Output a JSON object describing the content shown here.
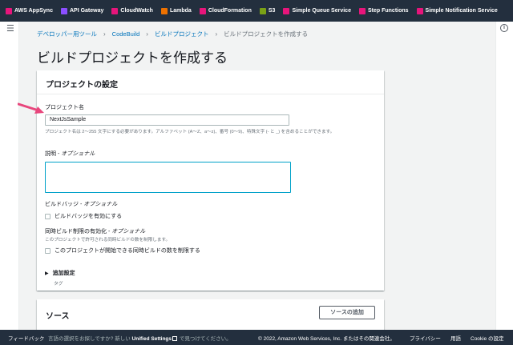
{
  "favorites": [
    {
      "label": "AWS AppSync",
      "color": "#e7157b"
    },
    {
      "label": "API Gateway",
      "color": "#8c4fff"
    },
    {
      "label": "CloudWatch",
      "color": "#e7157b"
    },
    {
      "label": "Lambda",
      "color": "#ed7100"
    },
    {
      "label": "CloudFormation",
      "color": "#e7157b"
    },
    {
      "label": "S3",
      "color": "#7aa116"
    },
    {
      "label": "Simple Queue Service",
      "color": "#e7157b"
    },
    {
      "label": "Step Functions",
      "color": "#e7157b"
    },
    {
      "label": "Simple Notification Service",
      "color": "#e7157b"
    }
  ],
  "breadcrumb": {
    "items": [
      "デベロッパー用ツール",
      "CodeBuild",
      "ビルドプロジェクト"
    ],
    "current": "ビルドプロジェクトを作成する"
  },
  "page_title": "ビルドプロジェクトを作成する",
  "config_panel": {
    "title": "プロジェクトの設定",
    "project_name": {
      "label": "プロジェクト名",
      "value": "NextJsSample",
      "hint": "プロジェクト名は 2〜255 文字にする必要があります。アルファベット (A〜Z、a〜z)、番号 (0〜9)、特殊文字 (- と _) を含めることができます。"
    },
    "description": {
      "label": "説明",
      "optional": "オプショナル"
    },
    "build_badge": {
      "label": "ビルドバッジ",
      "optional": "オプショナル",
      "checkbox_label": "ビルドバッジを有効にする"
    },
    "concurrency": {
      "label": "同時ビルド制限の有効化",
      "optional": "オプショナル",
      "hint": "このプロジェクトで許可される同時ビルドの数を制限します。",
      "checkbox_label": "このプロジェクトが開始できる同時ビルドの数を制限する"
    },
    "additional": {
      "label": "追加設定",
      "sub": "タグ"
    }
  },
  "source_panel": {
    "title": "ソース",
    "add_button": "ソースの追加"
  },
  "footer": {
    "feedback": "フィードバック",
    "lang_prefix": "言語の選択をお探しですか? 新しい",
    "unified": "Unified Settings",
    "lang_suffix": "で見つけてください。",
    "copyright": "© 2022, Amazon Web Services, Inc. またはその関連会社。",
    "privacy": "プライバシー",
    "terms": "用語",
    "cookie": "Cookie の設定"
  },
  "colors": {
    "accent_link": "#0073bb",
    "arrow": "#e8467c",
    "header_bg": "#232f3e"
  }
}
